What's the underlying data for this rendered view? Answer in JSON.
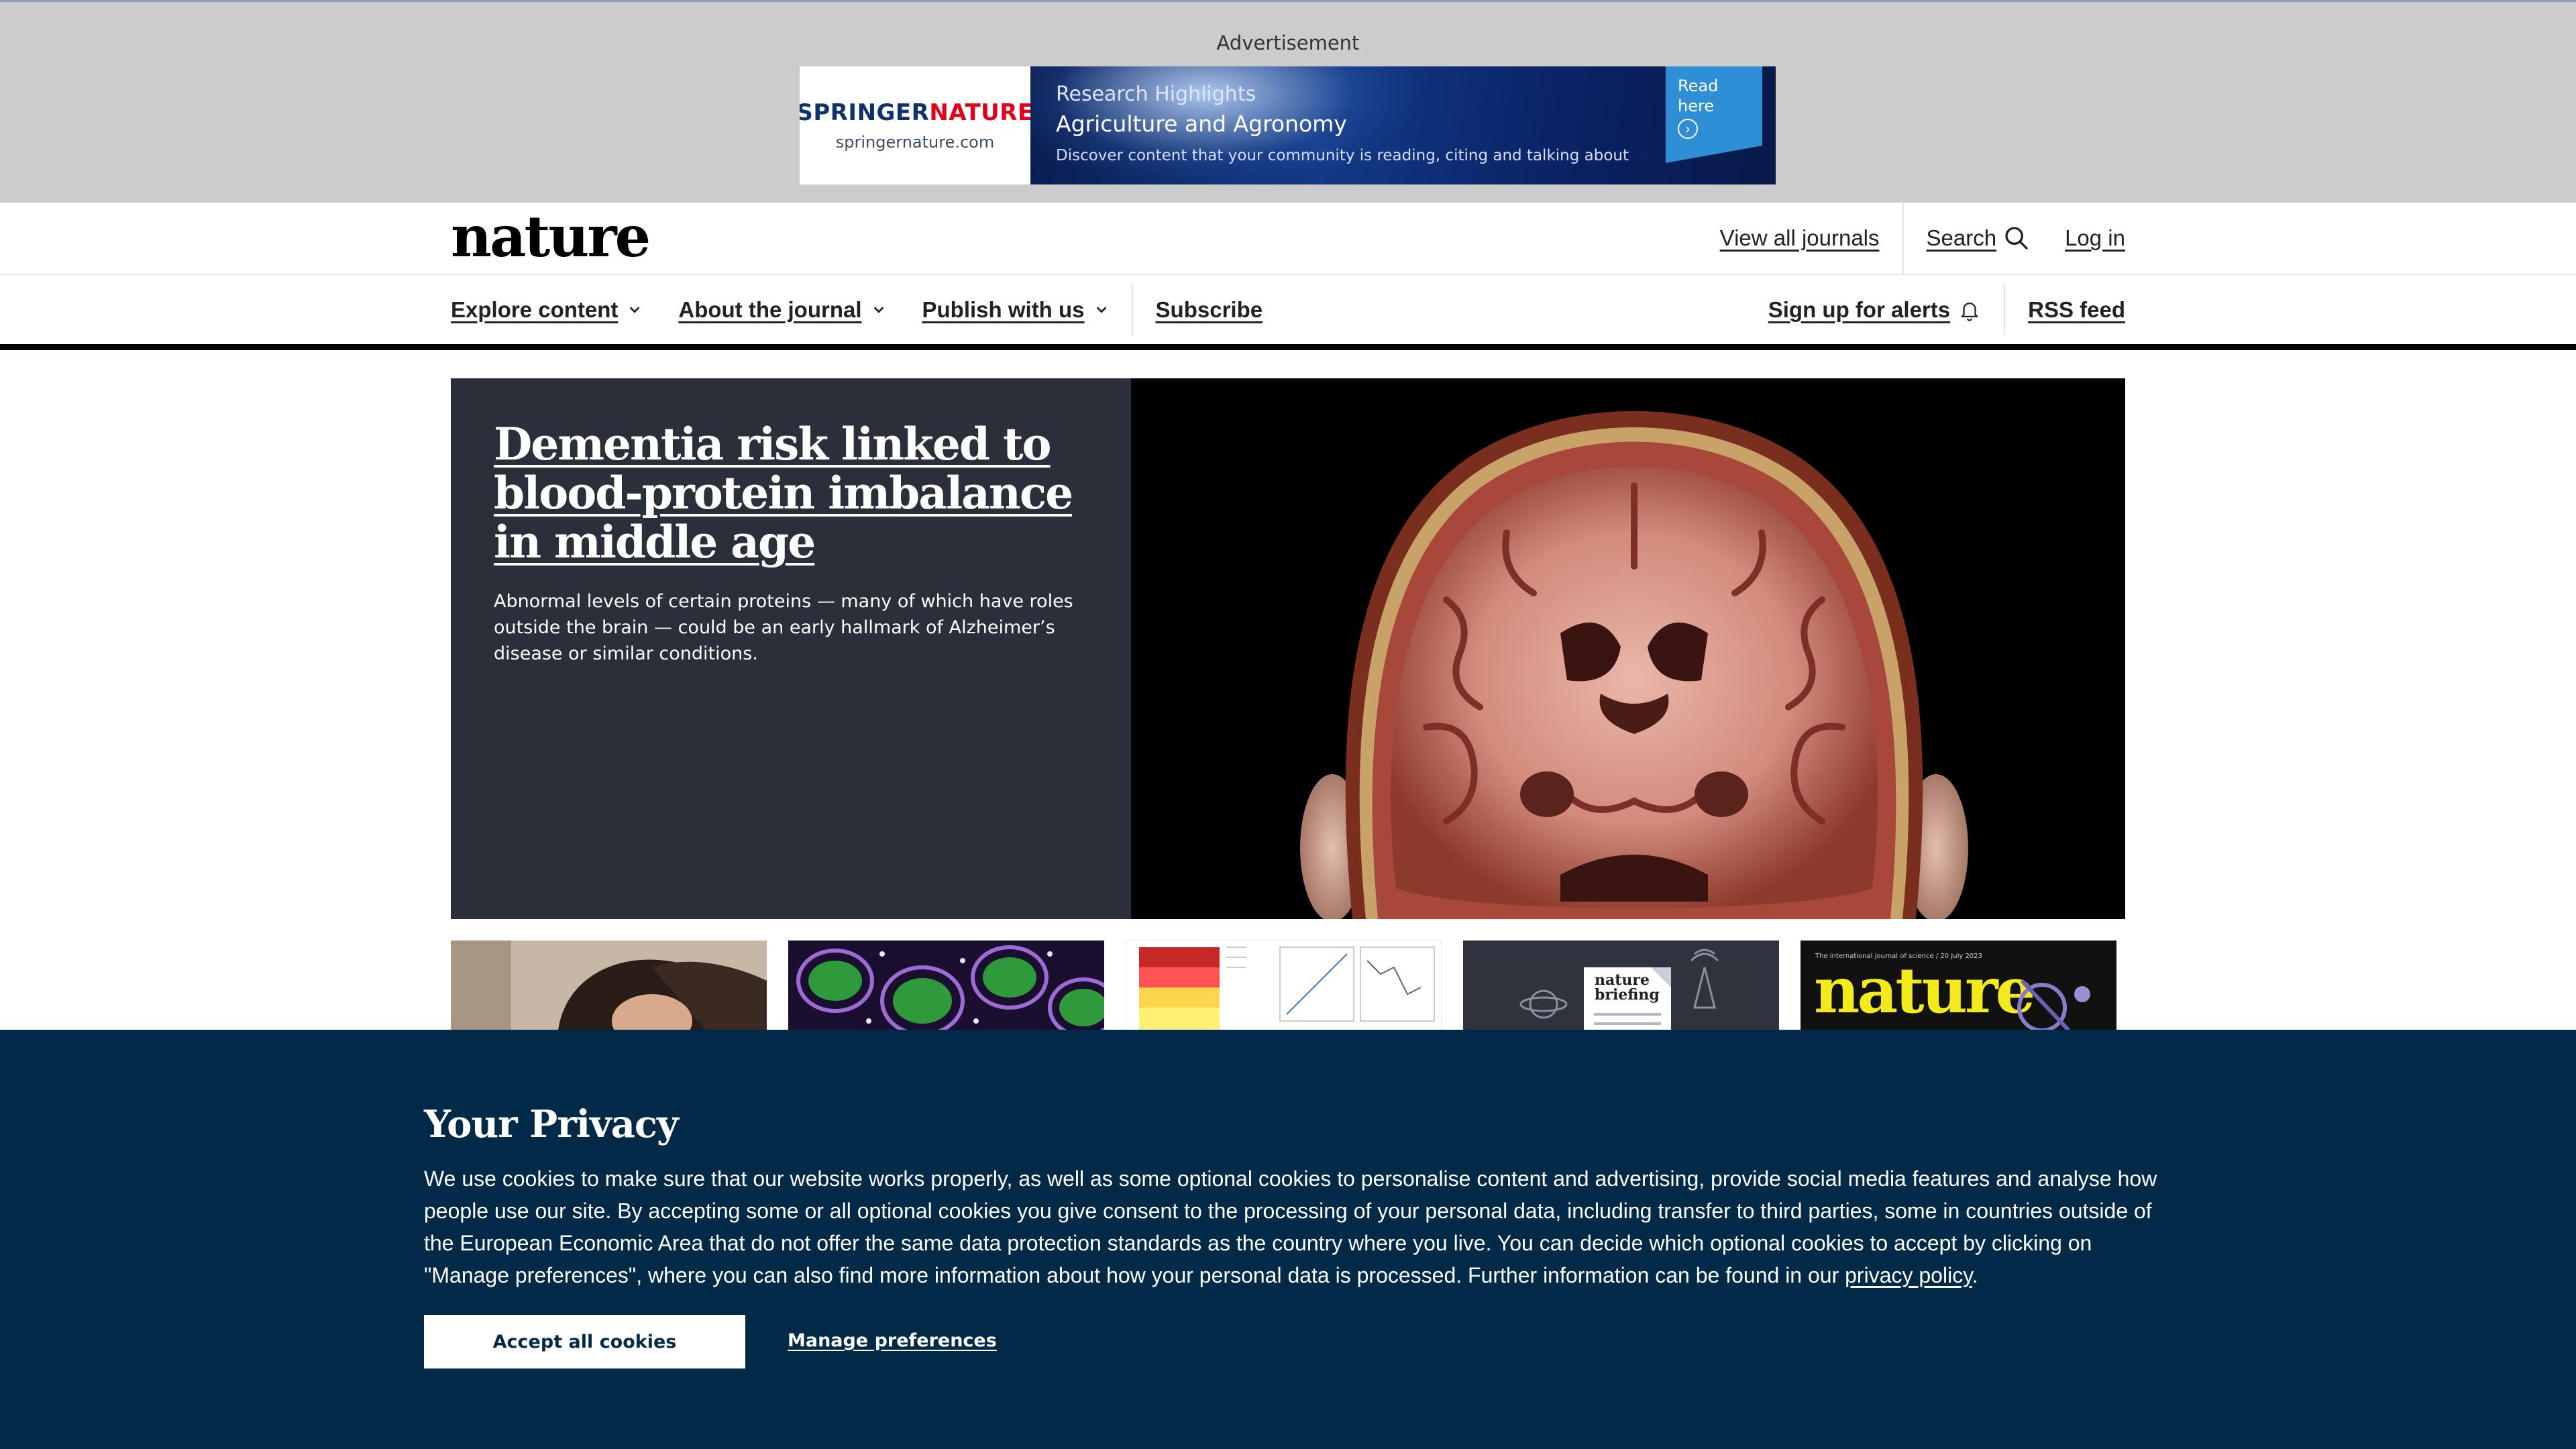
{
  "advertisement": {
    "label": "Advertisement",
    "brand_part1": "SPRINGER",
    "brand_part2": "NATURE",
    "brand_url": "springernature.com",
    "kicker": "Research Highlights",
    "headline": "Agriculture and Agronomy",
    "tagline": "Discover content that your community is reading, citing and talking about",
    "cta_line1": "Read",
    "cta_line2": "here",
    "cta_icon": "chevron-right-circle-icon"
  },
  "header": {
    "logo": "nature",
    "view_all_journals": "View all journals",
    "search": "Search",
    "search_icon": "search-icon",
    "log_in": "Log in"
  },
  "nav": {
    "items": [
      {
        "label": "Explore content",
        "has_dropdown": true
      },
      {
        "label": "About the journal",
        "has_dropdown": true
      },
      {
        "label": "Publish with us",
        "has_dropdown": true
      }
    ],
    "subscribe": "Subscribe",
    "alerts": "Sign up for alerts",
    "alerts_icon": "bell-icon",
    "rss": "RSS feed"
  },
  "hero": {
    "title": "Dementia risk linked to blood-protein imbalance in middle age",
    "standfirst": "Abnormal levels of certain proteins — many of which have roles outside the brain — could be an early hallmark of Alzheimer’s disease or similar conditions."
  },
  "thumbnails": {
    "briefing_line1": "nature",
    "briefing_line2": "briefing",
    "cover_masthead": "nature",
    "cover_strap": "The international journal of science / 20 July 2023"
  },
  "cookie": {
    "title": "Your Privacy",
    "text": "We use cookies to make sure that our website works properly, as well as some optional cookies to personalise content and advertising, provide social media features and analyse how people use our site. By accepting some or all optional cookies you give consent to the processing of your personal data, including transfer to third parties, some in countries outside of the European Economic Area that do not offer the same data protection standards as the country where you live. You can decide which optional cookies to accept by clicking on \"Manage preferences\", where you can also find more information about how your personal data is processed. Further information can be found in our ",
    "privacy_link": "privacy policy",
    "text_end": ".",
    "accept": "Accept all cookies",
    "manage": "Manage preferences"
  },
  "colors": {
    "ad_band": "#cccccc",
    "hero_panel": "#2b2f3a",
    "cookie_bg": "#002a48",
    "nav_rule": "#000000"
  }
}
